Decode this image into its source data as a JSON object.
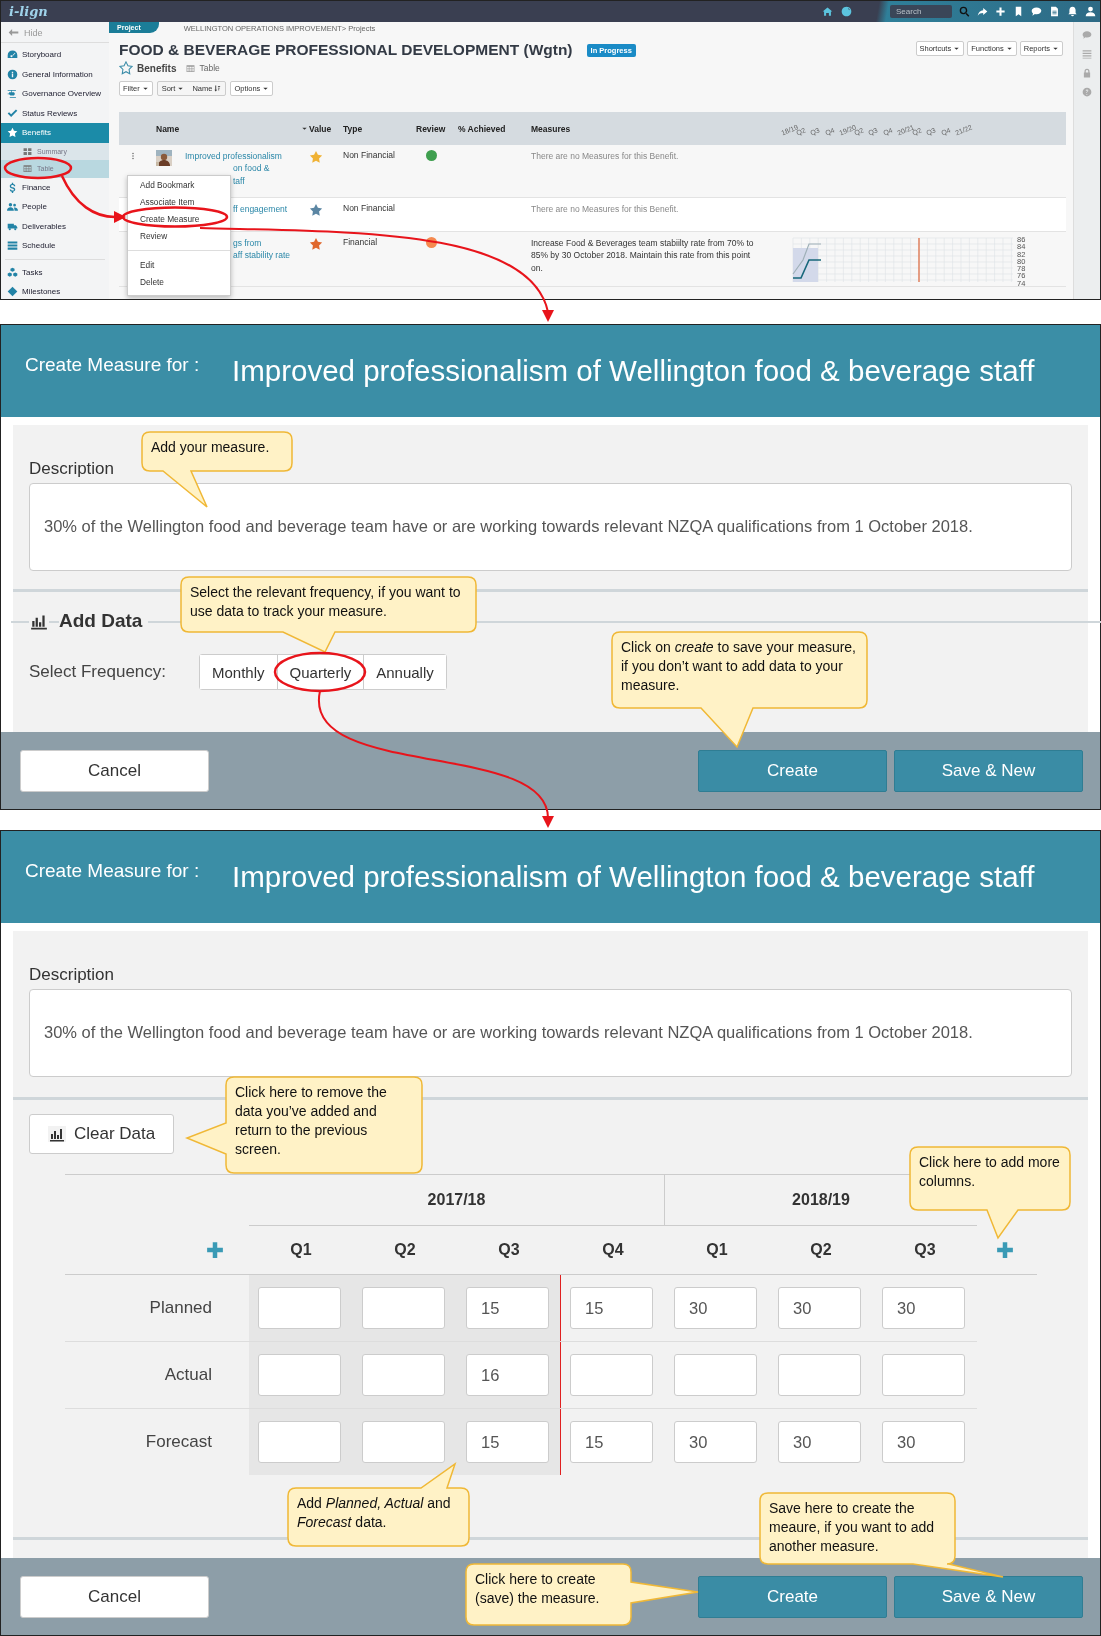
{
  "app_header": {
    "logo": "i-lign",
    "search": {
      "placeholder": "Search"
    }
  },
  "sidebar": {
    "hide": "Hide",
    "items": [
      {
        "label": "Storyboard",
        "selected": false
      },
      {
        "label": "General Information",
        "selected": false
      },
      {
        "label": "Governance Overview",
        "selected": false
      },
      {
        "label": "Status Reviews",
        "selected": false
      },
      {
        "label": "Benefits",
        "selected": true,
        "children": [
          {
            "label": "Summary",
            "selected": false
          },
          {
            "label": "Table",
            "selected": true
          }
        ]
      },
      {
        "label": "Finance",
        "selected": false
      },
      {
        "label": "People",
        "selected": false
      },
      {
        "label": "Deliverables",
        "selected": false
      },
      {
        "label": "Schedule",
        "selected": false
      },
      {
        "label": "Tasks",
        "selected": false
      },
      {
        "label": "Milestones",
        "selected": false
      }
    ]
  },
  "project": {
    "tab": "Project",
    "breadcrumb": "WELLINGTON OPERATIONS IMPROVEMENT> Projects",
    "title": "FOOD & BEVERAGE PROFESSIONAL DEVELOPMENT (Wgtn)",
    "status": "In Progress",
    "actions": [
      "Shortcuts",
      "Functions",
      "Reports"
    ],
    "section": "Benefits",
    "view": "Table",
    "toolbar": {
      "filter": "Filter",
      "sort": "Sort",
      "sort_field": "Name",
      "options": "Options"
    }
  },
  "benefits_table": {
    "columns": [
      "Name",
      "Value",
      "Type",
      "Review",
      "% Achieved",
      "Measures"
    ],
    "timeline": [
      "18/19",
      "Q2",
      "Q3",
      "Q4",
      "19/20",
      "Q2",
      "Q3",
      "Q4",
      "20/21",
      "Q2",
      "Q3",
      "Q4",
      "21/22"
    ],
    "rows": [
      {
        "name_lines": [
          "Improved professionalism",
          "on food &",
          "taff"
        ],
        "value": {
          "color": "#f0b234"
        },
        "type": "Non Financial",
        "review": {
          "color": "#3f9f4f"
        },
        "measures": "There are no Measures for this Benefit."
      },
      {
        "name_lines": [
          "ff engagement"
        ],
        "value": {
          "color": "#5b86a3"
        },
        "type": "Non Financial",
        "measures": "There are no Measures for this Benefit."
      },
      {
        "name_lines": [
          "gs from",
          "aff stability rate"
        ],
        "value": {
          "color": "#e0672c"
        },
        "type": "Financial",
        "review": {
          "color": "#f5894f"
        },
        "measures": "Increase Food & Beverages team stabiilty rate from 70% to 85% by 30 October 2018. Maintain this rate from this point on.",
        "chart": {
          "axis_labels": [
            "86",
            "84",
            "82",
            "80",
            "78",
            "76",
            "74"
          ]
        }
      }
    ]
  },
  "context_menu": {
    "groups": [
      [
        "Add Bookmark",
        "Associate Item",
        "Create Measure",
        "Review"
      ],
      [
        "Edit",
        "Delete"
      ]
    ]
  },
  "create_dialog": {
    "heading": "Create Measure for :",
    "benefit": "Improved professionalism of Wellington food & beverage staff",
    "description_label": "Description",
    "description": "30% of the Wellington food and beverage team have or are working towards relevant NZQA qualifications from 1 October 2018.",
    "add_data": "Add Data",
    "frequency_label": "Select Frequency:",
    "frequencies": [
      "Monthly",
      "Quarterly",
      "Annually"
    ],
    "buttons": {
      "cancel": "Cancel",
      "create": "Create",
      "save_new": "Save & New"
    },
    "callouts": [
      "Add your measure.",
      "Select the relevant frequency, if you want to use data to track your measure.",
      "Click on *create* to save your measure, if you don’t want to add data to your measure."
    ]
  },
  "data_dialog": {
    "heading": "Create Measure for :",
    "benefit": "Improved professionalism of Wellington food & beverage staff",
    "description_label": "Description",
    "description": "30% of the Wellington food and beverage team have or are working towards relevant NZQA qualifications from 1 October 2018.",
    "clear_data": "Clear Data",
    "years": [
      {
        "label": "2017/18",
        "quarters": [
          {
            "label": "Q1",
            "past": true
          },
          {
            "label": "Q2",
            "past": true
          },
          {
            "label": "Q3",
            "past": true,
            "planned": "15",
            "actual": "16",
            "forecast": "15"
          },
          {
            "label": "Q4",
            "past": false,
            "planned": "15",
            "forecast": "15"
          }
        ]
      },
      {
        "label": "2018/19",
        "quarters": [
          {
            "label": "Q1",
            "past": false,
            "planned": "30",
            "forecast": "30"
          },
          {
            "label": "Q2",
            "past": false,
            "planned": "30",
            "forecast": "30"
          },
          {
            "label": "Q3",
            "past": false,
            "planned": "30",
            "forecast": "30"
          }
        ]
      }
    ],
    "rows": [
      {
        "label": "Planned",
        "kind": "planned"
      },
      {
        "label": "Actual",
        "kind": "actual"
      },
      {
        "label": "Forecast",
        "kind": "forecast"
      }
    ],
    "buttons": {
      "cancel": "Cancel",
      "create": "Create",
      "save_new": "Save & New"
    },
    "callouts": [
      "Click here to remove the data you’ve added and return to the previous screen.",
      "Click here to add more columns.",
      "Add *Planned, Actual* and *Forecast* data.",
      "Save here to create the meaure, if you want to add another measure.",
      "Click here to create (save) the measure."
    ]
  }
}
